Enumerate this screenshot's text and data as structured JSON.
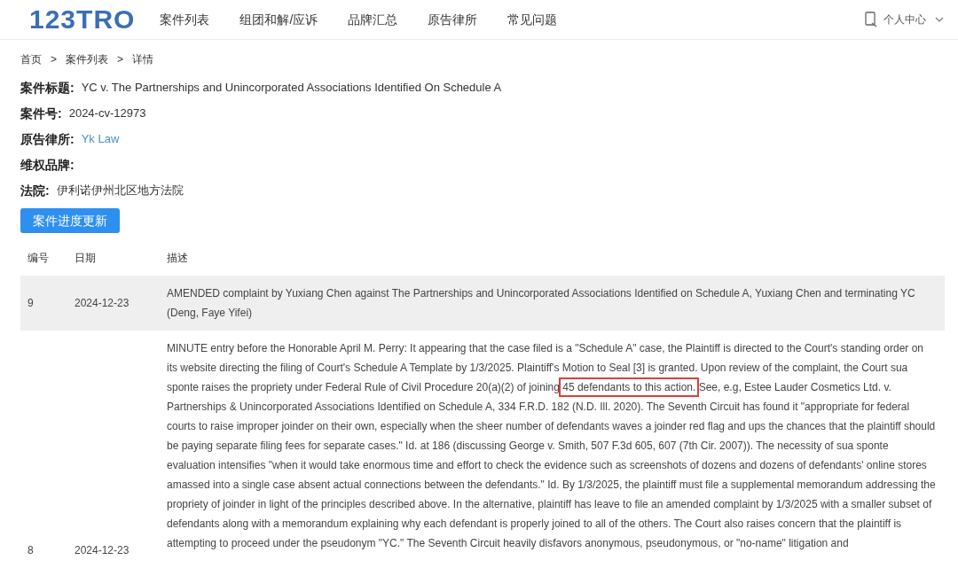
{
  "header": {
    "logo": "123TRO",
    "nav": [
      {
        "label": "案件列表"
      },
      {
        "label": "组团和解/应诉"
      },
      {
        "label": "品牌汇总"
      },
      {
        "label": "原告律所"
      },
      {
        "label": "常见问题"
      }
    ],
    "user_menu": "个人中心"
  },
  "breadcrumb": [
    "首页",
    ">",
    "案件列表",
    ">",
    "详情"
  ],
  "fields": [
    {
      "label": "案件标题:",
      "value": "YC v. The Partnerships and Unincorporated Associations Identified On Schedule A",
      "kind": "text"
    },
    {
      "label": "案件号:",
      "value": "2024-cv-12973",
      "kind": "text"
    },
    {
      "label": "原告律所:",
      "value": "Yk Law",
      "kind": "link"
    },
    {
      "label": "维权品牌:"
    },
    {
      "label": "法院:",
      "value": "伊利诺伊州北区地方法院",
      "kind": "text"
    }
  ],
  "update_button": "案件进度更新",
  "table": {
    "columns": [
      "编号",
      "日期",
      "描述"
    ],
    "rows": [
      {
        "number": "9",
        "date": "2024-12-23",
        "shaded": true,
        "description": [
          {
            "text": "AMENDED complaint by Yuxiang Chen against The Partnerships and Unincorporated Associations Identified on Schedule A, Yuxiang Chen and terminating YC (Deng, Faye Yifei)",
            "highlighted": false
          }
        ]
      },
      {
        "number": "8",
        "date": "2024-12-23",
        "shaded": false,
        "description": [
          {
            "text": "MINUTE entry before the Honorable April M. Perry: It appearing that the case filed is a \"Schedule A\" case, the Plaintiff is directed to the Court's standing order on its website directing the filing of Court's Schedule A Template by 1/3/2025. Plaintiff's Motion to Seal [3] is granted. Upon review of the complaint, the Court sua sponte raises the propriety under Federal Rule of Civil Procedure 20(a)(2) of joining ",
            "highlighted": false
          },
          {
            "text": "45 defendants to this action.",
            "highlighted": true
          },
          {
            "text": " See, e.g, Estee Lauder Cosmetics Ltd. v. Partnerships & Unincorporated Associations Identified on Schedule A, 334 F.R.D. 182 (N.D. Ill. 2020). The Seventh Circuit has found it \"appropriate for federal courts to raise improper joinder on their own, especially when the sheer number of defendants waves a joinder red flag and ups the chances that the plaintiff should be paying separate filing fees for separate cases.\" Id. at 186 (discussing George v. Smith, 507 F.3d 605, 607 (7th Cir. 2007)). The necessity of sua sponte evaluation intensifies \"when it would take enormous time and effort to check the evidence such as screenshots of dozens and dozens of defendants' online stores amassed into a single case absent actual connections between the defendants.\" Id. By 1/3/2025, the plaintiff must file a supplemental memorandum addressing the propriety of joinder in light of the principles described above. In the alternative, plaintiff has leave to file an amended complaint by 1/3/2025 with a smaller subset of defendants along with a memorandum explaining why each defendant is properly joined to all of the others. The Court also raises concern that the plaintiff is attempting to proceed under the pseudonym \"YC.\" The Seventh Circuit heavily disfavors anonymous, pseudonymous, or \"no-name\" litigation and",
            "highlighted": false
          }
        ]
      }
    ]
  }
}
